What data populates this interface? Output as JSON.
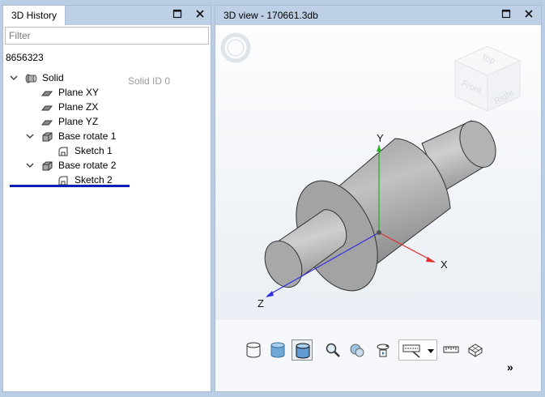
{
  "left_panel": {
    "tab_label": "3D History",
    "filter_placeholder": "Filter",
    "model_id": "8656323",
    "solid_id_label": "Solid ID 0",
    "tree": [
      {
        "label": "Solid",
        "icon": "solid-icon",
        "expanded": true
      },
      {
        "label": "Plane XY",
        "icon": "plane-icon"
      },
      {
        "label": "Plane ZX",
        "icon": "plane-icon"
      },
      {
        "label": "Plane YZ",
        "icon": "plane-icon"
      },
      {
        "label": "Base rotate 1",
        "icon": "base-rotate-icon",
        "expanded": true
      },
      {
        "label": "Sketch 1",
        "icon": "sketch-icon"
      },
      {
        "label": "Base rotate 2",
        "icon": "base-rotate-icon",
        "expanded": true
      },
      {
        "label": "Sketch 2",
        "icon": "sketch-icon"
      }
    ]
  },
  "right_panel": {
    "tab_label": "3D view - 170661.3db",
    "view_cube": {
      "top": "Top",
      "front": "Front",
      "right": "Right"
    },
    "axes": {
      "x": "X",
      "y": "Y",
      "z": "Z"
    },
    "toolbar": [
      "wireframe-cylinder-icon",
      "shaded-cylinder-icon",
      "shaded-edges-cylinder-icon",
      "zoom-icon",
      "zoom-selection-icon",
      "rotate-view-icon",
      "view-options-icon",
      "dropdown-arrow-icon",
      "measure-ruler-icon",
      "grid-cube-icon",
      "more-icon"
    ],
    "more_label": "»"
  },
  "colors": {
    "background": "#b9cde5",
    "titlebar": "#bdd0e6",
    "selection_underline": "#0a1fb3",
    "axis_x": "#e03030",
    "axis_y": "#20b020",
    "axis_z": "#3030e0"
  }
}
